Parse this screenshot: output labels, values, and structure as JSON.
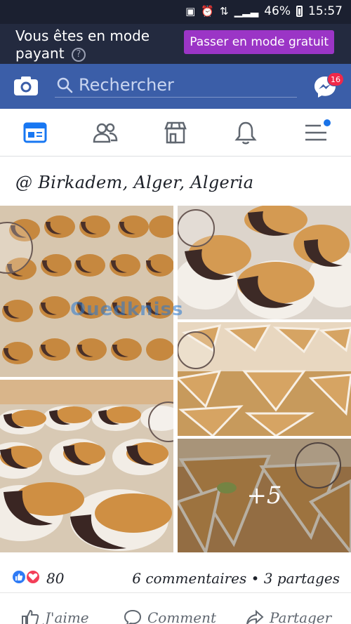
{
  "status_bar": {
    "battery_percent": "46%",
    "time": "15:57",
    "icons": [
      "sim-icon",
      "alarm-icon",
      "data-icon",
      "signal-icon",
      "battery-icon"
    ]
  },
  "banner": {
    "message": "Vous êtes en mode payant",
    "help_icon": "?",
    "button_label": "Passer en mode gratuit",
    "button_color": "#9b35c6"
  },
  "top_bar": {
    "search_placeholder": "Rechercher",
    "messenger_badge": "16",
    "bar_color": "#3b5ea8"
  },
  "tabs": [
    {
      "name": "news-feed",
      "icon": "news-feed-icon",
      "active": true
    },
    {
      "name": "friends",
      "icon": "friends-icon"
    },
    {
      "name": "marketplace",
      "icon": "marketplace-icon"
    },
    {
      "name": "notifications",
      "icon": "bell-icon"
    },
    {
      "name": "menu",
      "icon": "menu-icon",
      "has_dot": true
    }
  ],
  "post": {
    "location": "@ Birkadem, Alger, Algeria",
    "watermark": "Ouedkniss",
    "more_photos": "+5",
    "reaction_count": "80",
    "comments_shares": "6 commentaires • 3 partages",
    "actions": {
      "like": "J'aime",
      "comment": "Comment",
      "share": "Partager"
    }
  }
}
